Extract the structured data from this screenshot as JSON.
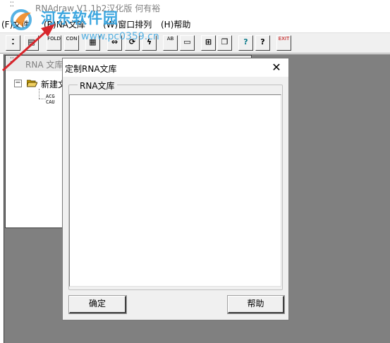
{
  "app": {
    "title": "RNAdraw V1.1b2汉化版 何有裕"
  },
  "menu": {
    "items": [
      {
        "label": "(F)文件"
      },
      {
        "label": "(R)NA文库"
      },
      {
        "label": "(W)窗口排列"
      },
      {
        "label": "(H)帮助"
      }
    ]
  },
  "toolbar": {
    "buttons": [
      {
        "icon": "new-icon",
        "glyph": "⁚"
      },
      {
        "icon": "open-icon",
        "glyph": "▤"
      },
      {
        "icon": "fold-icon",
        "label": "FOLD"
      },
      {
        "icon": "con-icon",
        "label": "CON"
      },
      {
        "icon": "print-icon",
        "glyph": "▦"
      },
      {
        "icon": "move-icon",
        "glyph": "⇔"
      },
      {
        "icon": "rotate-icon",
        "glyph": "⟳"
      },
      {
        "icon": "lightning-icon",
        "glyph": "ϟ"
      },
      {
        "icon": "ab-icon",
        "label": "AB"
      },
      {
        "icon": "edit-icon",
        "glyph": "▭"
      },
      {
        "icon": "tile-icon",
        "glyph": "⊞"
      },
      {
        "icon": "cascade-icon",
        "glyph": "❐"
      },
      {
        "icon": "help-question-icon",
        "glyph": "?"
      },
      {
        "icon": "context-help-icon",
        "glyph": "?"
      },
      {
        "icon": "exit-icon",
        "label": "EXIT"
      }
    ]
  },
  "library_window": {
    "title": "RNA 文库",
    "tree_root": "新建文",
    "tree_child": "ACG\nCAU"
  },
  "dialog": {
    "title": "定制RNA文库",
    "close_glyph": "✕",
    "groupbox_label": "RNA文库",
    "ok_label": "确定",
    "help_label": "帮助"
  },
  "watermark": {
    "site_name": "河东软件园",
    "url": "www.pc0359.cn"
  },
  "colors": {
    "client_bg": "#808080",
    "dialog_bg": "#f0f0f0",
    "watermark": "#3aa5df",
    "arrow": "#d8252b"
  }
}
